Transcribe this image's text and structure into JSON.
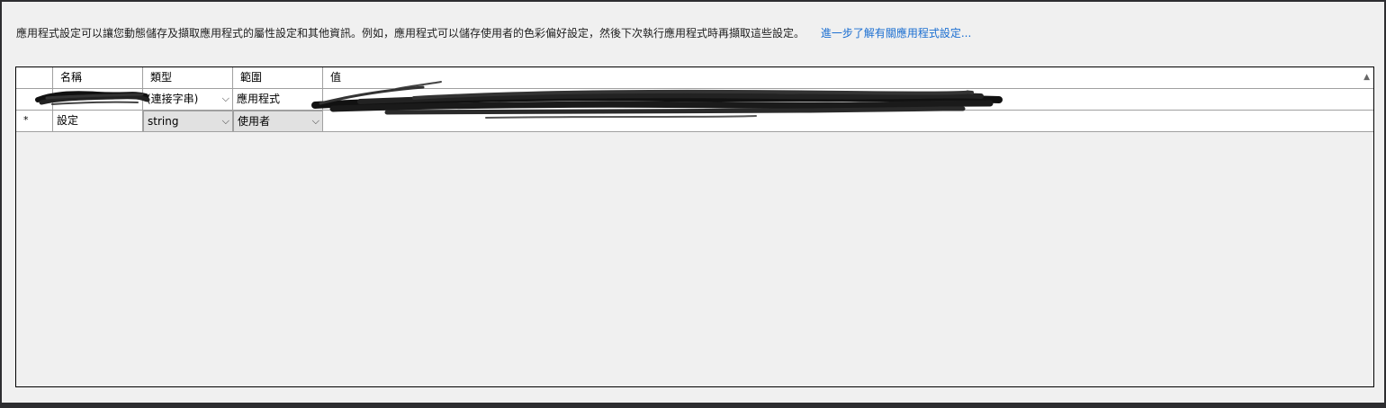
{
  "description": {
    "text": "應用程式設定可以讓您動態儲存及擷取應用程式的屬性設定和其他資訊。例如，應用程式可以儲存使用者的色彩偏好設定，然後下次執行應用程式時再擷取這些設定。",
    "link": "進一步了解有關應用程式設定..."
  },
  "grid": {
    "columns": [
      "名稱",
      "類型",
      "範圍",
      "值"
    ],
    "rows": [
      {
        "marker": "",
        "name": "",
        "type": "(連接字串)",
        "scope": "應用程式",
        "value": ""
      },
      {
        "marker": "*",
        "name": "設定",
        "type": "string",
        "scope": "使用者",
        "value": ""
      }
    ]
  },
  "icons": {
    "dropdown": "chevron-down-icon",
    "sort": "sort-up-icon"
  }
}
